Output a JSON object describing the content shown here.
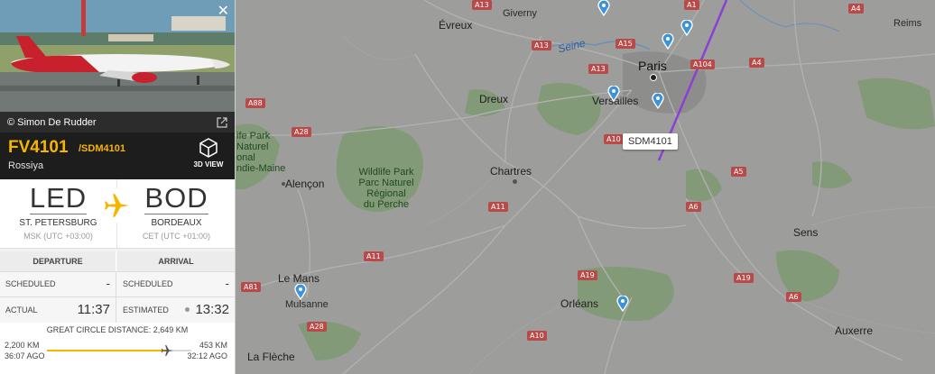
{
  "map": {
    "cities": [
      {
        "name": "Évreux"
      },
      {
        "name": "Giverny"
      },
      {
        "name": "Paris"
      },
      {
        "name": "Versailles"
      },
      {
        "name": "Dreux"
      },
      {
        "name": "Chartres"
      },
      {
        "name": "Alençon"
      },
      {
        "name": "Sens"
      },
      {
        "name": "Le Mans"
      },
      {
        "name": "Mulsanne"
      },
      {
        "name": "Orléans"
      },
      {
        "name": "Auxerre"
      },
      {
        "name": "La Flèche"
      },
      {
        "name": "Reims"
      }
    ],
    "river": "Seine",
    "parks": {
      "perche_title": "Wildlife Park",
      "perche_line1": "Parc Naturel",
      "perche_line2": "Régional",
      "perche_line3": "du Perche",
      "left_title": "ife Park",
      "left_line1": "Naturel",
      "left_line2": "onal",
      "left_line3": "ndie-Maine"
    },
    "roads": [
      "A13",
      "A1",
      "A15",
      "A13",
      "A13",
      "A104",
      "A4",
      "A4",
      "A88",
      "A28",
      "A10",
      "A5",
      "A11",
      "A6",
      "A11",
      "A81",
      "A19",
      "A19",
      "A28",
      "A10",
      "A6"
    ],
    "aircraft_label": "SDM4101"
  },
  "panel": {
    "photo_credit": "© Simon De Rudder",
    "flight_number": "FV4101",
    "callsign": "/SDM4101",
    "airline": "Rossiya",
    "view3d_label": "3D VIEW",
    "origin": {
      "code": "LED",
      "city": "ST. PETERSBURG",
      "tz": "MSK (UTC +03:00)"
    },
    "destination": {
      "code": "BOD",
      "city": "BORDEAUX",
      "tz": "CET (UTC +01:00)"
    },
    "departure_header": "DEPARTURE",
    "arrival_header": "ARRIVAL",
    "scheduled_label": "SCHEDULED",
    "dep_scheduled_value": "-",
    "arr_scheduled_value": "-",
    "actual_label": "ACTUAL",
    "actual_value": "11:37",
    "estimated_label": "ESTIMATED",
    "estimated_value": "13:32",
    "gcd_label": "GREAT CIRCLE DISTANCE: 2,649 KM",
    "distance_flown": "2,200 KM",
    "time_ago": "36:07 AGO",
    "distance_remaining": "453 KM",
    "time_remaining": "32:12 AGO",
    "progress": 0.83,
    "accent": "#f7b500"
  }
}
